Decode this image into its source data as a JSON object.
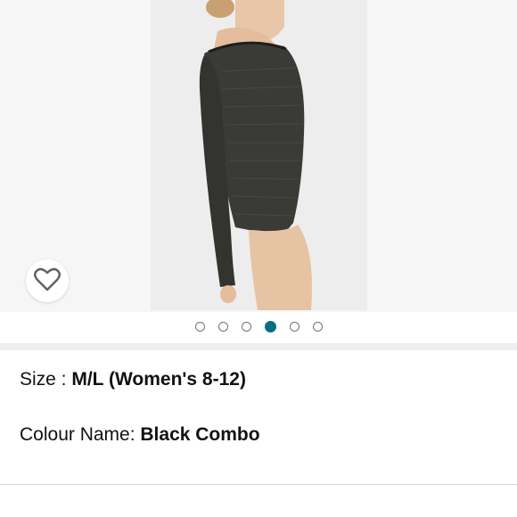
{
  "product_image": {
    "alt": "Black Combo bodysuit",
    "wishlist_icon": "heart-outline-icon",
    "carousel": {
      "total": 6,
      "active_index": 3
    }
  },
  "details": {
    "size_label": "Size : ",
    "size_value": "M/L (Women's 8-12)",
    "colour_label": "Colour Name: ",
    "colour_value": "Black Combo"
  },
  "colors": {
    "accent": "#007185",
    "dot_border": "#6f7373",
    "background": "#ffffff",
    "band": "#eeeeee"
  }
}
